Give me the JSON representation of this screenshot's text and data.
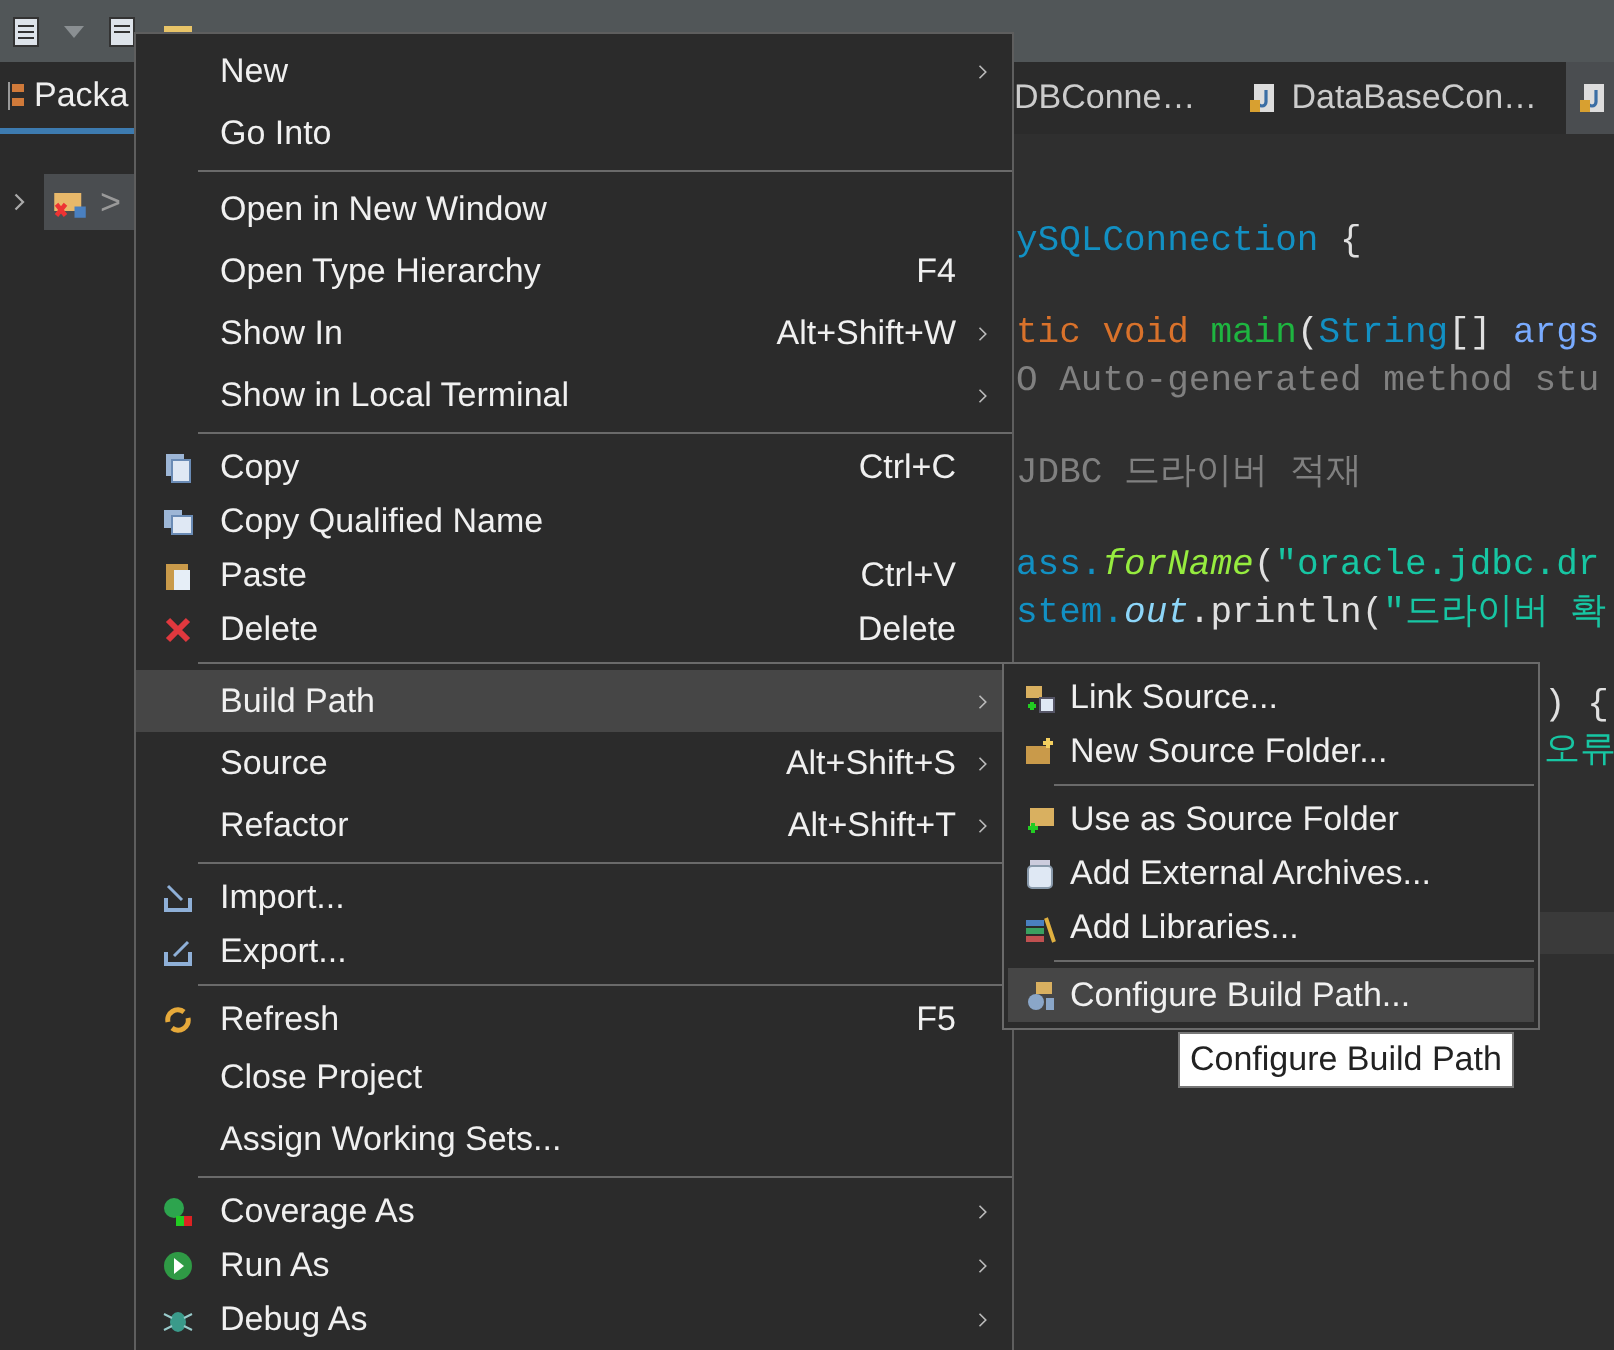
{
  "views": {
    "package_tab": {
      "label": "Packa",
      "selected": true
    },
    "tree": [
      {
        "label": ">",
        "selected": true
      }
    ]
  },
  "editor": {
    "tabs": [
      {
        "label": "DBConne…",
        "selected": false
      },
      {
        "label": "DataBaseCon…",
        "selected": false
      },
      {
        "selected": true
      }
    ],
    "lines": [
      {
        "kind": "code",
        "tokens": [
          {
            "kind": "type",
            "text": "ySQLConnection "
          },
          {
            "kind": "plain",
            "text": "{"
          }
        ]
      },
      {
        "kind": "blank"
      },
      {
        "kind": "code",
        "tokens": [
          {
            "kind": "keyword",
            "text": "tic void "
          },
          {
            "kind": "method",
            "text": "main"
          },
          {
            "kind": "plain",
            "text": "("
          },
          {
            "kind": "type",
            "text": "String"
          },
          {
            "kind": "plain",
            "text": "[] "
          },
          {
            "kind": "param",
            "text": "args"
          }
        ]
      },
      {
        "kind": "code",
        "tokens": [
          {
            "kind": "comment",
            "text": "O Auto-generated method stu"
          }
        ]
      },
      {
        "kind": "blank"
      },
      {
        "kind": "code",
        "tokens": [
          {
            "kind": "comment",
            "text": "JDBC 드라이버 적재"
          }
        ]
      },
      {
        "kind": "blank"
      },
      {
        "kind": "code",
        "tokens": [
          {
            "kind": "type",
            "text": "ass."
          },
          {
            "kind": "static",
            "text": "forName"
          },
          {
            "kind": "plain",
            "text": "("
          },
          {
            "kind": "string",
            "text": "\"oracle.jdbc.dr"
          }
        ]
      },
      {
        "kind": "code",
        "tokens": [
          {
            "kind": "type",
            "text": "stem."
          },
          {
            "kind": "field",
            "text": "out"
          },
          {
            "kind": "plain",
            "text": ".println("
          },
          {
            "kind": "string",
            "text": "\"드라이버 확"
          }
        ]
      },
      {
        "kind": "blank"
      },
      {
        "kind": "tail",
        "tokens": [
          {
            "kind": "plain",
            "text": ") {"
          }
        ]
      },
      {
        "kind": "tail",
        "tokens": [
          {
            "kind": "korean",
            "text": "오류"
          }
        ]
      }
    ]
  },
  "context_menu": {
    "groups": [
      [
        {
          "label": "New",
          "submenu": true,
          "selected": false
        },
        {
          "label": "Go Into",
          "submenu": false,
          "selected": false
        }
      ],
      [
        {
          "label": "Open in New Window",
          "submenu": false,
          "selected": false
        },
        {
          "label": "Open Type Hierarchy",
          "shortcut": "F4",
          "submenu": false,
          "selected": false
        },
        {
          "label": "Show In",
          "shortcut": "Alt+Shift+W",
          "submenu": true,
          "selected": false
        },
        {
          "label": "Show in Local Terminal",
          "submenu": true,
          "selected": false
        }
      ],
      [
        {
          "label": "Copy",
          "kind": "copy",
          "shortcut": "Ctrl+C",
          "submenu": false,
          "selected": false
        },
        {
          "label": "Copy Qualified Name",
          "kind": "copyname",
          "submenu": false,
          "selected": false
        },
        {
          "label": "Paste",
          "kind": "paste",
          "shortcut": "Ctrl+V",
          "submenu": false,
          "selected": false
        },
        {
          "label": "Delete",
          "kind": "delete",
          "shortcut": "Delete",
          "submenu": false,
          "selected": false
        }
      ],
      [
        {
          "label": "Build Path",
          "submenu": true,
          "selected": true
        },
        {
          "label": "Source",
          "shortcut": "Alt+Shift+S",
          "submenu": true,
          "selected": false
        },
        {
          "label": "Refactor",
          "shortcut": "Alt+Shift+T",
          "submenu": true,
          "selected": false
        }
      ],
      [
        {
          "label": "Import...",
          "kind": "import",
          "submenu": false,
          "selected": false
        },
        {
          "label": "Export...",
          "kind": "export",
          "submenu": false,
          "selected": false
        }
      ],
      [
        {
          "label": "Refresh",
          "kind": "refresh",
          "shortcut": "F5",
          "submenu": false,
          "selected": false
        },
        {
          "label": "Close Project",
          "submenu": false,
          "selected": false
        },
        {
          "label": "Assign Working Sets...",
          "submenu": false,
          "selected": false
        }
      ],
      [
        {
          "label": "Coverage As",
          "kind": "coverage",
          "submenu": true,
          "selected": false
        },
        {
          "label": "Run As",
          "kind": "run",
          "submenu": true,
          "selected": false
        },
        {
          "label": "Debug As",
          "kind": "debug",
          "submenu": true,
          "selected": false
        }
      ]
    ]
  },
  "submenu": {
    "groups": [
      [
        {
          "label": "Link Source...",
          "kind": "link",
          "selected": false
        },
        {
          "label": "New Source Folder...",
          "kind": "newfolder",
          "selected": false
        }
      ],
      [
        {
          "label": "Use as Source Folder",
          "kind": "usefolder",
          "selected": false
        },
        {
          "label": "Add External Archives...",
          "kind": "jar",
          "selected": false
        },
        {
          "label": "Add Libraries...",
          "kind": "library",
          "selected": false
        }
      ],
      [
        {
          "label": "Configure Build Path...",
          "kind": "configure",
          "selected": true
        }
      ]
    ]
  },
  "tooltip": {
    "text": "Configure Build Path"
  }
}
